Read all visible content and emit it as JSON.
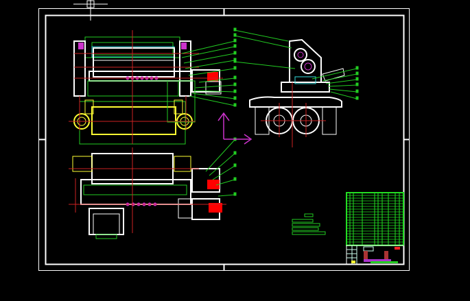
{
  "app": {
    "view": "cad-model-space"
  },
  "colors": {
    "background": "#000000",
    "frame": "#ffffff",
    "outline": "#22cc22",
    "centerline": "#cc2222",
    "accent_yellow": "#ffff33",
    "cyan": "#33dddd",
    "magenta": "#cc33cc",
    "motor_red": "#ff0000",
    "title_block": "#22dd22"
  },
  "icons": {
    "ucs": "ucs-axis-icon",
    "crosshair": "crosshair-cursor-icon"
  }
}
